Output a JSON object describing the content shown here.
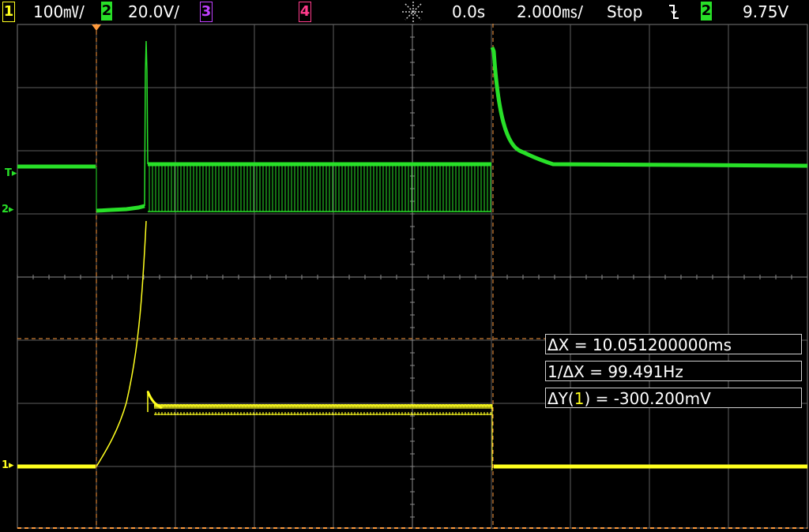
{
  "status_bar": {
    "ch1": {
      "num": "1",
      "scale": "100㎷/",
      "color": "#ffff1e"
    },
    "ch2": {
      "num": "2",
      "scale": "20.0V/",
      "color": "#28e028"
    },
    "ch3": {
      "num": "3",
      "color": "#c040ff"
    },
    "ch4": {
      "num": "4",
      "color": "#ff3b8b"
    },
    "trigger_icon": "trigger-position-icon",
    "delay": "0.0s",
    "timebase": "2.000㎳/",
    "run_state": "Stop",
    "trigger_slope_icon": "falling-edge-icon",
    "trigger_source": "2",
    "trigger_level": "9.75V"
  },
  "markers": {
    "trigger": "T",
    "ch2_ground": "2",
    "ch1_ground": "1"
  },
  "measurements": {
    "delta_x": "ΔX = 10.051200000ms",
    "inv_delta_x": "1/ΔX = 99.491Hz",
    "delta_y_prefix": "ΔY(",
    "delta_y_channel": "1",
    "delta_y_suffix": ") = -300.200mV"
  },
  "colors": {
    "ch1": "#ffff1e",
    "ch2": "#28e028",
    "grid": "#7a7a7a",
    "cursor": "#ff9a3c"
  }
}
